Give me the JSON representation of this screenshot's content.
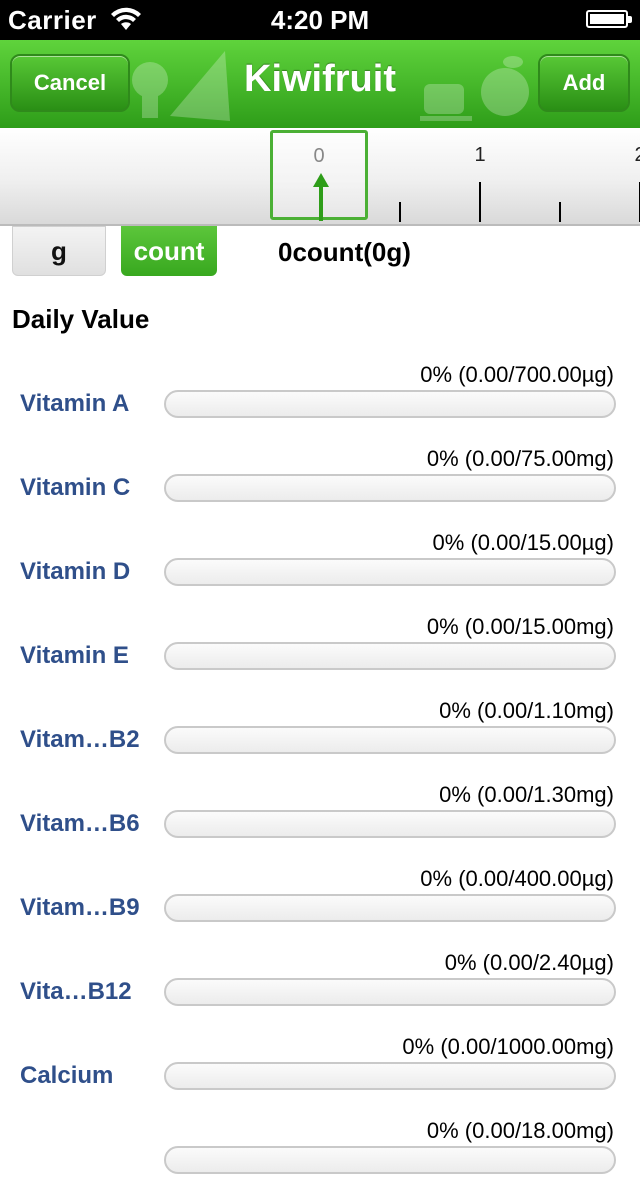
{
  "status_bar": {
    "carrier": "Carrier",
    "time": "4:20 PM"
  },
  "nav": {
    "cancel_label": "Cancel",
    "title": "Kiwifruit",
    "add_label": "Add"
  },
  "ruler": {
    "selected_value": "0",
    "labels": [
      "1",
      "2"
    ]
  },
  "units": {
    "g_label": "g",
    "count_label": "count",
    "selected": "count",
    "amount_text": "0count(0g)"
  },
  "daily_value": {
    "title": "Daily Value",
    "items": [
      {
        "name": "Vitamin A",
        "value_text": "0% (0.00/700.00µg)",
        "fraction": 0
      },
      {
        "name": "Vitamin C",
        "value_text": "0% (0.00/75.00mg)",
        "fraction": 0
      },
      {
        "name": "Vitamin D",
        "value_text": "0% (0.00/15.00µg)",
        "fraction": 0
      },
      {
        "name": "Vitamin E",
        "value_text": "0% (0.00/15.00mg)",
        "fraction": 0
      },
      {
        "name": "Vitam…B2",
        "value_text": "0% (0.00/1.10mg)",
        "fraction": 0
      },
      {
        "name": "Vitam…B6",
        "value_text": "0% (0.00/1.30mg)",
        "fraction": 0
      },
      {
        "name": "Vitam…B9",
        "value_text": "0% (0.00/400.00µg)",
        "fraction": 0
      },
      {
        "name": "Vita…B12",
        "value_text": "0% (0.00/2.40µg)",
        "fraction": 0
      },
      {
        "name": "Calcium",
        "value_text": "0% (0.00/1000.00mg)",
        "fraction": 0
      },
      {
        "name": "",
        "value_text": "0% (0.00/18.00mg)",
        "fraction": 0
      }
    ]
  },
  "colors": {
    "nav_green": "#2e9d19",
    "nutrient_name": "#2f4f8a"
  }
}
